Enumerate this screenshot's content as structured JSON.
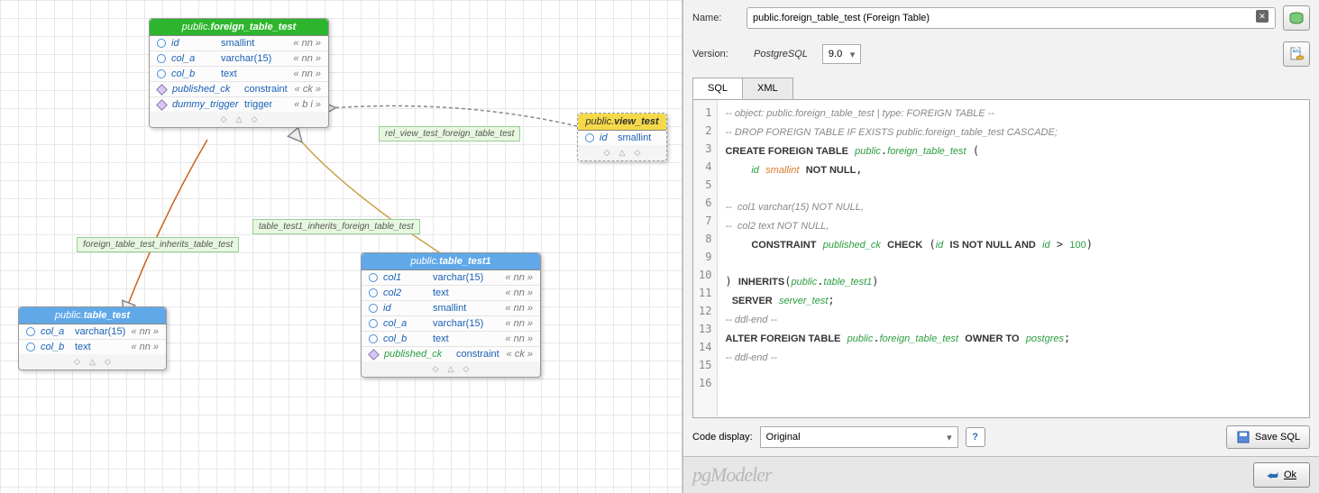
{
  "entities": {
    "foreign_table": {
      "schema": "public.",
      "name": "foreign_table_test",
      "cols": [
        {
          "n": "id",
          "t": "smallint",
          "f": "« nn »"
        },
        {
          "n": "col_a",
          "t": "varchar(15)",
          "f": "« nn »"
        },
        {
          "n": "col_b",
          "t": "text",
          "f": "« nn »"
        }
      ],
      "cons": [
        {
          "n": "published_ck",
          "t": "constraint",
          "f": "« ck »"
        },
        {
          "n": "dummy_trigger",
          "t": "trigger",
          "f": "« b i »"
        }
      ]
    },
    "view_test": {
      "schema": "public.",
      "name": "view_test",
      "cols": [
        {
          "n": "id",
          "t": "smallint",
          "f": ""
        }
      ]
    },
    "table_test1": {
      "schema": "public.",
      "name": "table_test1",
      "cols": [
        {
          "n": "col1",
          "t": "varchar(15)",
          "f": "« nn »"
        },
        {
          "n": "col2",
          "t": "text",
          "f": "« nn »"
        },
        {
          "n": "id",
          "t": "smallint",
          "f": "« nn »"
        },
        {
          "n": "col_a",
          "t": "varchar(15)",
          "f": "« nn »"
        },
        {
          "n": "col_b",
          "t": "text",
          "f": "« nn »"
        }
      ],
      "cons": [
        {
          "n": "published_ck",
          "t": "constraint",
          "f": "« ck »"
        }
      ]
    },
    "table_test": {
      "schema": "public.",
      "name": "table_test",
      "cols": [
        {
          "n": "col_a",
          "t": "varchar(15)",
          "f": "« nn »"
        },
        {
          "n": "col_b",
          "t": "text",
          "f": "« nn »"
        }
      ]
    }
  },
  "rels": {
    "r1": "rel_view_test_foreign_table_test",
    "r2": "table_test1_inherits_foreign_table_test",
    "r3": "foreign_table_test_inherits_table_test"
  },
  "panel": {
    "name_label": "Name:",
    "name_value": "public.foreign_table_test (Foreign Table)",
    "version_label": "Version:",
    "version_engine": "PostgreSQL",
    "version_num": "9.0",
    "tabs": {
      "sql": "SQL",
      "xml": "XML"
    },
    "code_display_label": "Code display:",
    "code_display_value": "Original",
    "save_sql": "Save SQL",
    "ok": "Ok",
    "logo": "pgModeler"
  },
  "sql": {
    "l1": "-- object: public.foreign_table_test | type: FOREIGN TABLE --",
    "l2": "-- DROP FOREIGN TABLE IF EXISTS public.foreign_table_test CASCADE;",
    "l12": "-- ddl-end --",
    "l14": "-- ddl-end --"
  }
}
